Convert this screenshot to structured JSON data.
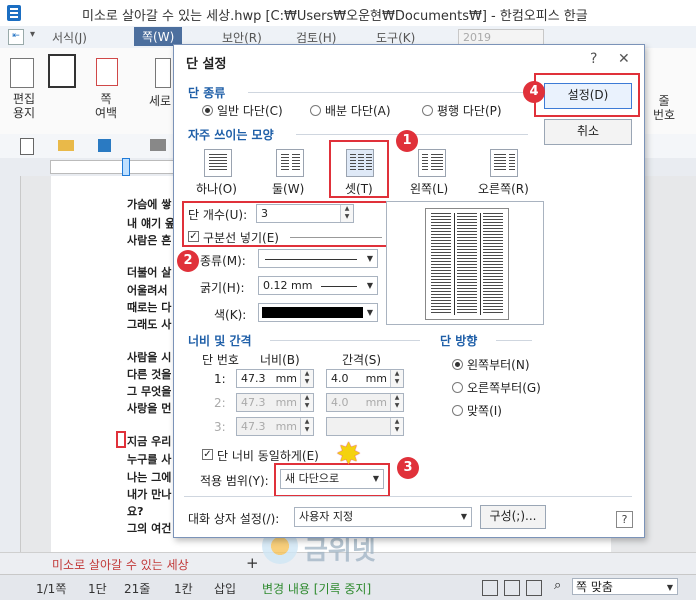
{
  "window": {
    "title": "미소로 살아갈 수 있는 세상.hwp [C:₩Users₩오운현₩Documents₩] - 한컴오피스 한글"
  },
  "menu": {
    "items": [
      "서식(J)",
      "쪽(W)",
      "보안(R)",
      "검토(H)",
      "도구(K)"
    ],
    "active": "쪽(W)",
    "zoom_field": "2019"
  },
  "ribbon": {
    "edit_paper": "편집\n용지",
    "page_margin": "쪽\n여백",
    "vertical": "세로",
    "extra1": "줄\n번호"
  },
  "doc": {
    "lines": [
      "가슴에 쌓",
      "내 얘기 옾",
      "사람은 흔",
      "더불어 살",
      "어울려서",
      "때로는 다",
      "그래도 사",
      "사람을 시",
      "다른 것을",
      "그 무엇을",
      "사랑을 먼",
      "지금 우리",
      "누구를 사",
      "나는 그에",
      "내가 만나",
      "요?",
      "그의 여건"
    ],
    "tab_name": "미소로 살아갈 수 있는 세상"
  },
  "dialog": {
    "title": "단 설정",
    "help": "?",
    "close": "✕",
    "col_type": {
      "label": "단 종류",
      "options": [
        "일반 다단(C)",
        "배분 다단(A)",
        "평행 다단(P)"
      ],
      "selected": 0
    },
    "presets": {
      "label": "자주 쓰이는 모양",
      "items": [
        "하나(O)",
        "둘(W)",
        "셋(T)",
        "왼쪽(L)",
        "오른쪽(R)"
      ],
      "selected": 2
    },
    "col_count": {
      "label": "단 개수(U):",
      "value": "3"
    },
    "divider": {
      "label": "구분선 넣기(E)",
      "checked": true
    },
    "type": {
      "label": "종류(M):"
    },
    "thickness": {
      "label": "굵기(H):",
      "value": "0.12 mm"
    },
    "color": {
      "label": "색(K):",
      "value": "#000000"
    },
    "width_section": {
      "label": "너비 및 간격",
      "headers": [
        "단 번호",
        "너비(B)",
        "간격(S)"
      ],
      "rows": [
        {
          "num": "1:",
          "width": "47.3",
          "gap": "4.0",
          "unit": "mm",
          "enabled": true
        },
        {
          "num": "2:",
          "width": "47.3",
          "gap": "4.0",
          "unit": "mm",
          "enabled": false
        },
        {
          "num": "3:",
          "width": "47.3",
          "gap": "",
          "unit": "mm",
          "enabled": false
        }
      ]
    },
    "equal_width": {
      "label": "단 너비 동일하게(E)",
      "checked": true
    },
    "apply_scope": {
      "label": "적용 범위(Y):",
      "value": "새 다단으로"
    },
    "direction": {
      "label": "단 방향",
      "options": [
        "왼쪽부터(N)",
        "오른쪽부터(G)",
        "맞쪽(I)"
      ],
      "selected": 0
    },
    "ok_button": "설정(D)",
    "cancel_button": "취소",
    "dialog_settings": {
      "label": "대화 상자 설정(/):",
      "value": "사용자 지정"
    },
    "config_button": "구성(;)..."
  },
  "badges": [
    "1",
    "2",
    "3",
    "4"
  ],
  "status": {
    "page": "1/1쪽",
    "col": "1단",
    "line": "21줄",
    "char": "1칸",
    "insert": "삽입",
    "tracking": "변경 내용 [기록 중지]",
    "zoom": "쪽 맞춤"
  },
  "watermark": "금위넷",
  "colors": {
    "accent": "#1f5fa8",
    "highlight": "#e0313a",
    "menu_active": "#4c6f9e"
  }
}
